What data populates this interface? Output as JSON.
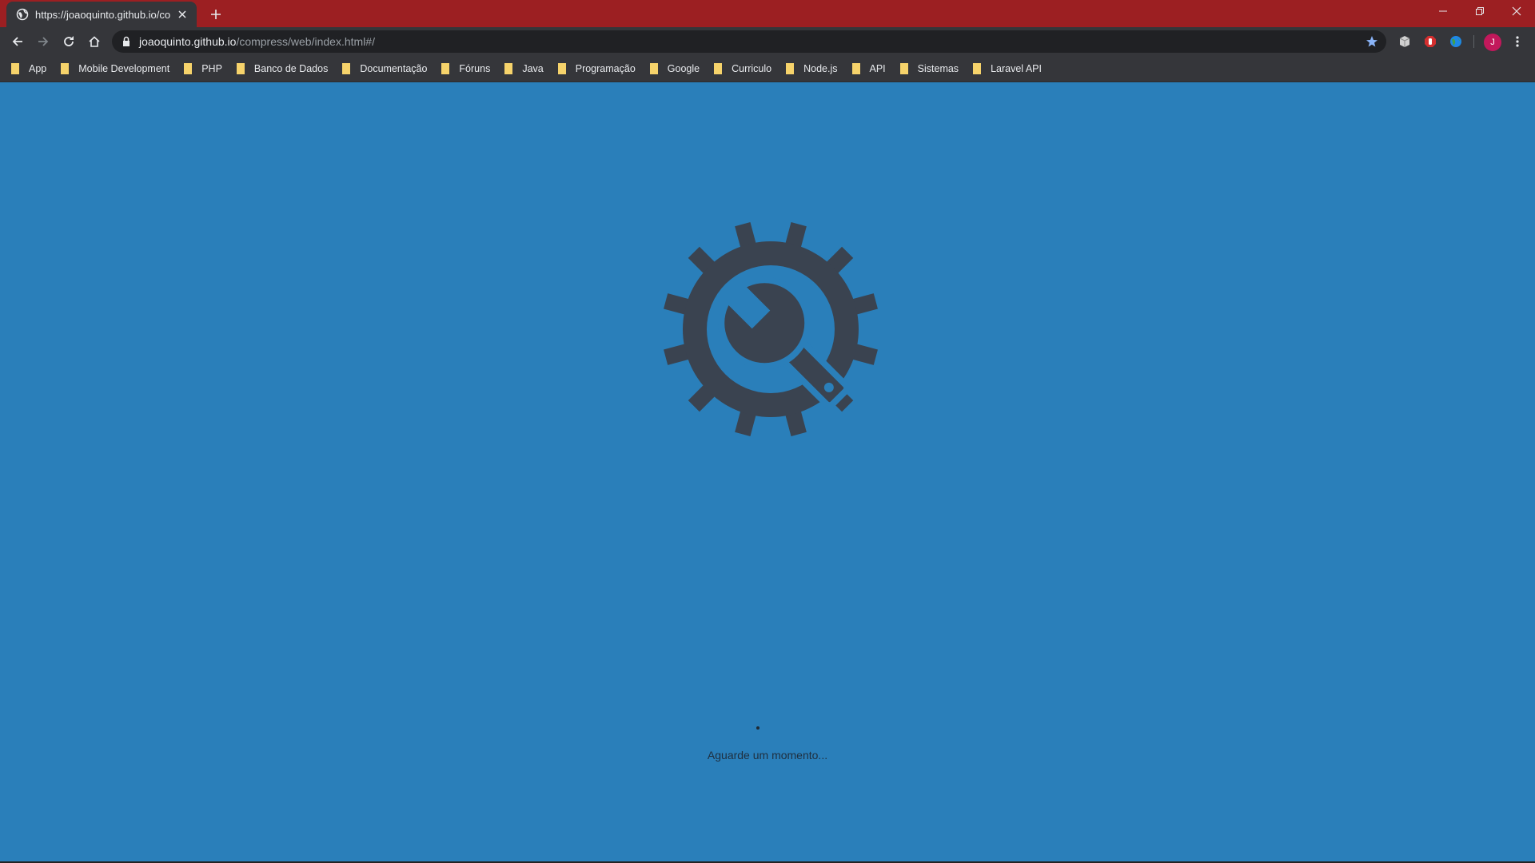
{
  "colors": {
    "tabstrip": "#9c1f22",
    "toolbar": "#35363a",
    "page_background": "#2a7fba",
    "gear": "#3a4350",
    "folder": "#f6d36b"
  },
  "tab": {
    "title": "https://joaoquinto.github.io/compress/web/index.html#/",
    "favicon": "globe-icon"
  },
  "omnibox": {
    "host": "joaoquinto.github.io",
    "path": "/compress/web/index.html#/"
  },
  "profile": {
    "initial": "J"
  },
  "bookmarks": [
    {
      "label": "App"
    },
    {
      "label": "Mobile Development"
    },
    {
      "label": "PHP"
    },
    {
      "label": "Banco de Dados"
    },
    {
      "label": "Documentação"
    },
    {
      "label": "Fóruns"
    },
    {
      "label": "Java"
    },
    {
      "label": "Programação"
    },
    {
      "label": "Google"
    },
    {
      "label": "Curriculo"
    },
    {
      "label": "Node.js"
    },
    {
      "label": "API"
    },
    {
      "label": "Sistemas"
    },
    {
      "label": "Laravel API"
    }
  ],
  "page": {
    "icon": "gear-wrench-icon",
    "loading_text": "Aguarde um momento..."
  }
}
